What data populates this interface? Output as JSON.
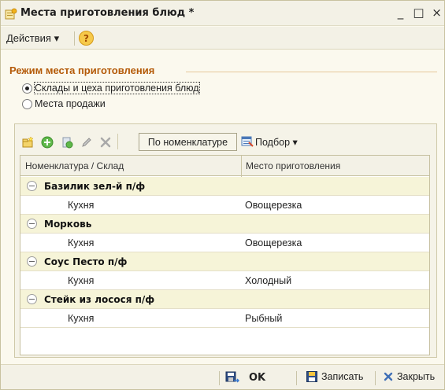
{
  "window": {
    "title": "Места приготовления блюд *",
    "minimize_glyph": "_",
    "maximize_glyph": "□",
    "close_glyph": "×"
  },
  "actions_bar": {
    "actions_label": "Действия ▾",
    "help_glyph": "?"
  },
  "mode_group": {
    "title": "Режим места приготовления",
    "options": [
      {
        "label": "Склады и цеха приготовления блюд",
        "selected": true
      },
      {
        "label": "Места продажи",
        "selected": false
      }
    ]
  },
  "table_toolbar": {
    "icons": [
      "add-icon",
      "add-group-icon",
      "copy-icon",
      "edit-icon",
      "delete-icon"
    ],
    "by_nomenclature_label": "По номенклатуре",
    "selection_label": "Подбор ▾"
  },
  "table": {
    "columns": [
      "Номенклатура / Склад",
      "Место приготовления"
    ],
    "groups": [
      {
        "name": "Базилик зел-й п/ф",
        "items": [
          {
            "name": "Кухня",
            "place": "Овощерезка"
          }
        ]
      },
      {
        "name": "Морковь",
        "items": [
          {
            "name": "Кухня",
            "place": "Овощерезка"
          }
        ]
      },
      {
        "name": "Соус Песто п/ф",
        "items": [
          {
            "name": "Кухня",
            "place": "Холодный"
          }
        ]
      },
      {
        "name": "Стейк из лосося п/ф",
        "items": [
          {
            "name": "Кухня",
            "place": "Рыбный"
          }
        ]
      }
    ]
  },
  "bottom_bar": {
    "ok_label": "OK",
    "save_label": "Записать",
    "close_label": "Закрыть"
  },
  "colors": {
    "group_title": "#b45a08",
    "group_row_bg": "#f6f4d8",
    "window_bg": "#fbf9ee"
  }
}
